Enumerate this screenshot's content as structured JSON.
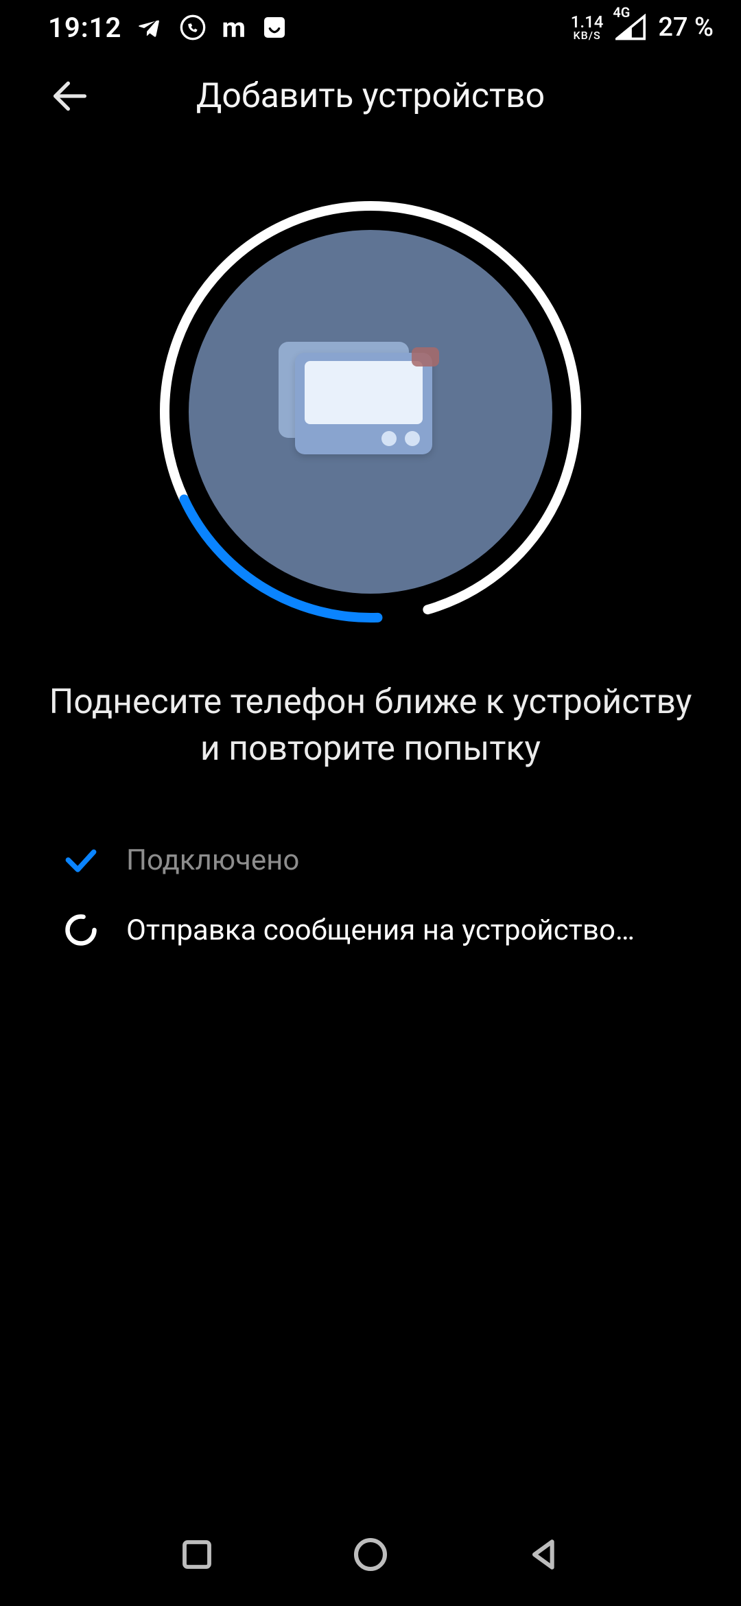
{
  "status_bar": {
    "time": "19:12",
    "net_speed_value": "1.14",
    "net_speed_unit": "KB/S",
    "network_label": "4G",
    "battery": "27 %",
    "icons": {
      "telegram": "telegram-icon",
      "viber": "viber-icon",
      "m": "m",
      "shop": "shop-icon"
    }
  },
  "header": {
    "title": "Добавить устройство"
  },
  "instruction": "Поднесите телефон ближе к устройству и повторите попытку",
  "steps": {
    "connected": "Подключено",
    "sending": "Отправка сообщения на устройство…"
  },
  "progress": {
    "percent": 20
  },
  "colors": {
    "accent": "#0a84ff",
    "disk": "#5f7494",
    "muted": "#8d8d8d"
  }
}
